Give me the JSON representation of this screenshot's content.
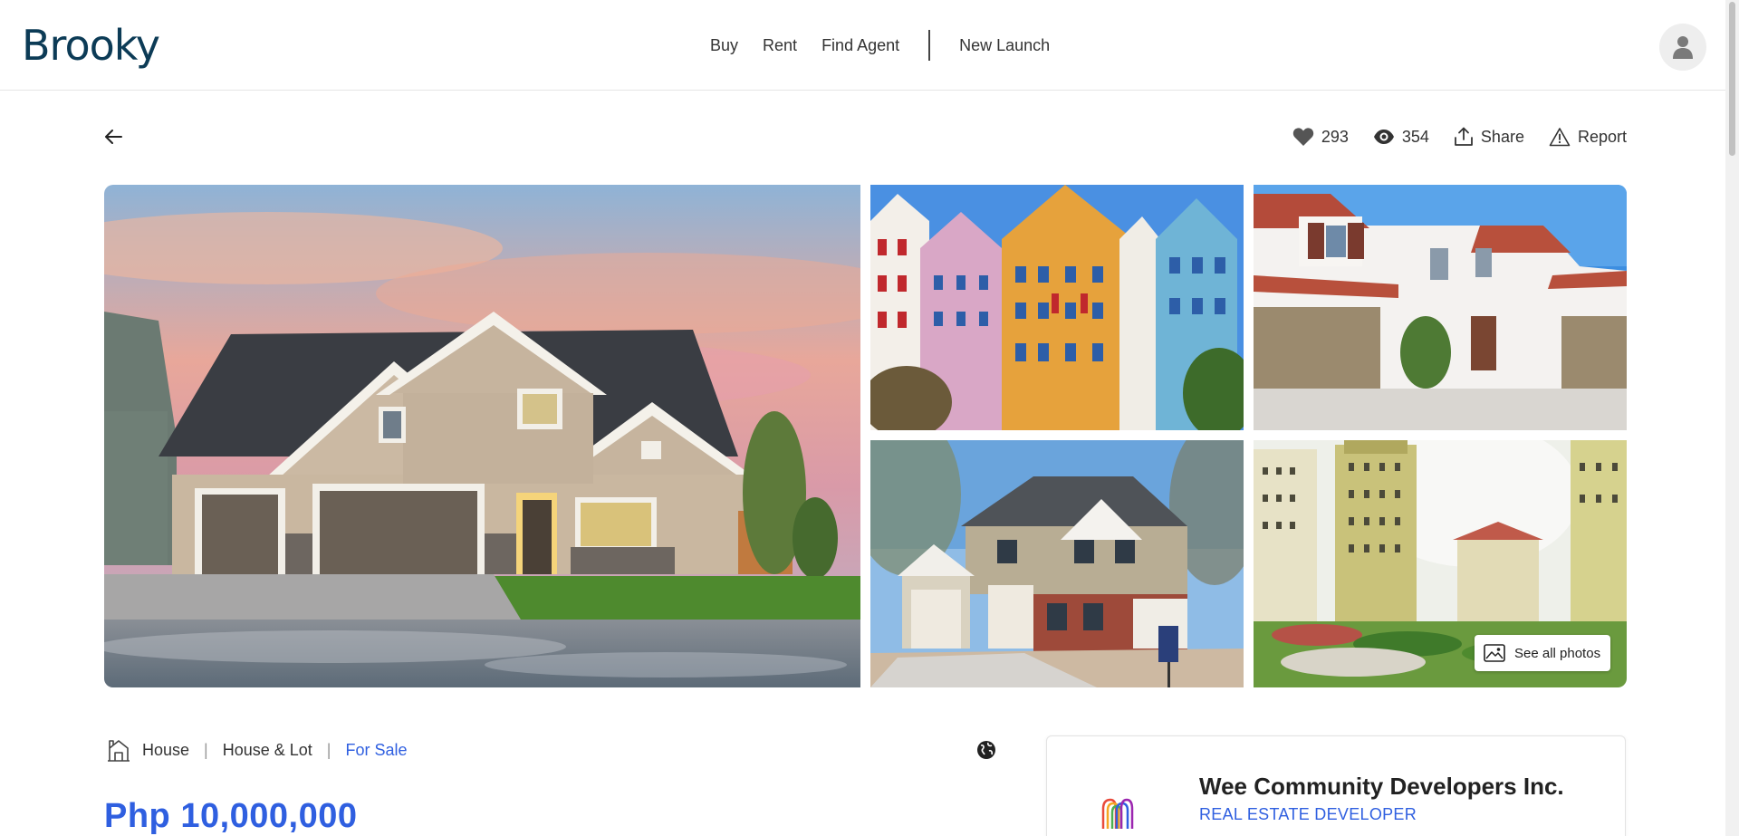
{
  "brand": {
    "logo_text": "Brooky",
    "color": "#0c3b56"
  },
  "nav": {
    "items": [
      {
        "label": "Buy"
      },
      {
        "label": "Rent"
      },
      {
        "label": "Find Agent"
      },
      {
        "label": "New Launch"
      }
    ]
  },
  "user": {
    "avatar_icon": "user-icon"
  },
  "stats": {
    "likes": "293",
    "views": "354",
    "share_label": "Share",
    "report_label": "Report"
  },
  "gallery": {
    "photos": [
      {
        "subject": "house-at-sunset"
      },
      {
        "subject": "colorful-townhouses"
      },
      {
        "subject": "white-villa"
      },
      {
        "subject": "brick-two-storey-house"
      },
      {
        "subject": "condominium-scale-model"
      }
    ],
    "see_all_label": "See all photos"
  },
  "listing": {
    "category": "House",
    "subcategory": "House & Lot",
    "status": "For Sale",
    "price": "Php 10,000,000"
  },
  "developer": {
    "name": "Wee Community Developers Inc.",
    "type": "REAL ESTATE DEVELOPER"
  },
  "colors": {
    "accent": "#2f5fe0",
    "brand": "#0c3b56"
  }
}
